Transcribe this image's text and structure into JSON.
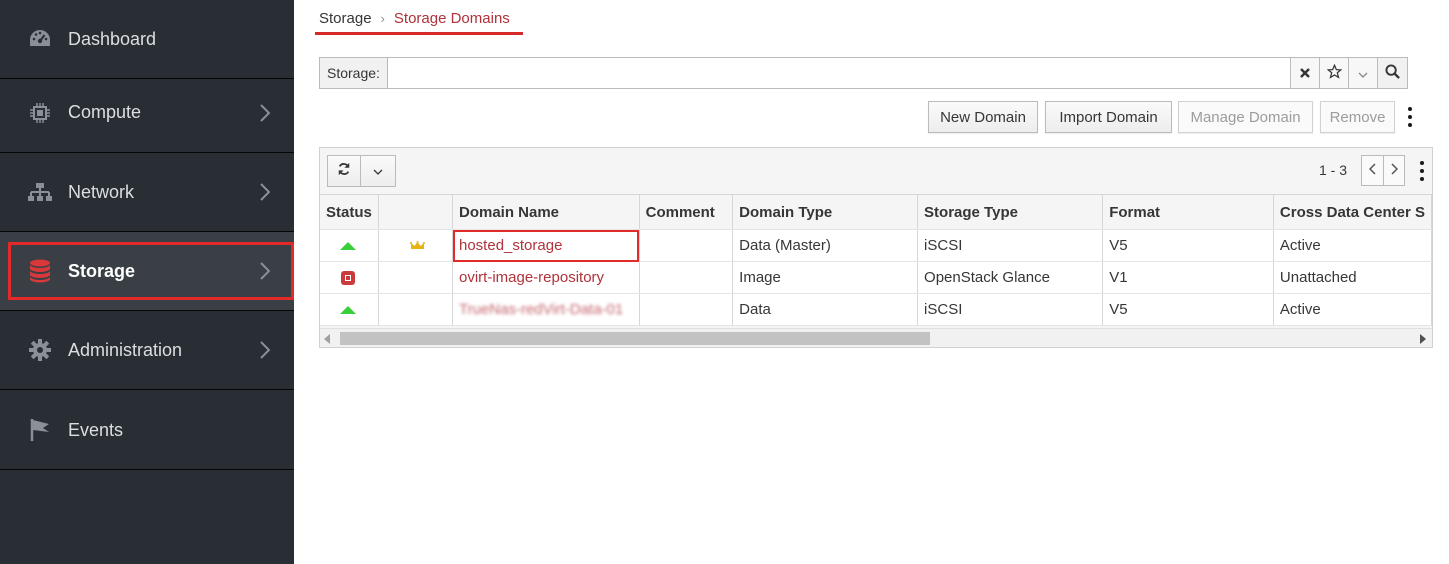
{
  "sidebar": {
    "items": [
      {
        "label": "Dashboard",
        "icon": "dashboard-icon"
      },
      {
        "label": "Compute",
        "icon": "chip-icon"
      },
      {
        "label": "Network",
        "icon": "network-icon"
      },
      {
        "label": "Storage",
        "icon": "database-icon"
      },
      {
        "label": "Administration",
        "icon": "gear-icon"
      },
      {
        "label": "Events",
        "icon": "flag-icon"
      }
    ],
    "active": "Storage"
  },
  "breadcrumb": {
    "parent": "Storage",
    "separator": "›",
    "current": "Storage Domains"
  },
  "search": {
    "label": "Storage:",
    "value": "",
    "placeholder": ""
  },
  "toolbar": {
    "new_domain": "New Domain",
    "import_domain": "Import Domain",
    "manage_domain": "Manage Domain",
    "remove": "Remove"
  },
  "grid": {
    "paging": "1 - 3",
    "columns": [
      "Status",
      "",
      "Domain Name",
      "Comment",
      "Domain Type",
      "Storage Type",
      "Format",
      "Cross Data Center S"
    ],
    "rows": [
      {
        "status": "up",
        "master": true,
        "name": "hosted_storage",
        "comment": "",
        "domain_type": "Data (Master)",
        "storage_type": "iSCSI",
        "format": "V5",
        "cross_dc_status": "Active"
      },
      {
        "status": "unattached",
        "master": false,
        "name": "ovirt-image-repository",
        "comment": "",
        "domain_type": "Image",
        "storage_type": "OpenStack Glance",
        "format": "V1",
        "cross_dc_status": "Unattached"
      },
      {
        "status": "up",
        "master": false,
        "name": "TrueNas-redVirt-Data-01",
        "comment": "",
        "domain_type": "Data",
        "storage_type": "iSCSI",
        "format": "V5",
        "cross_dc_status": "Active"
      }
    ]
  },
  "colors": {
    "sidebar_bg": "#292e34",
    "link": "#b0323a",
    "highlight": "#e22a2a",
    "status_up": "#3ccf3c"
  }
}
